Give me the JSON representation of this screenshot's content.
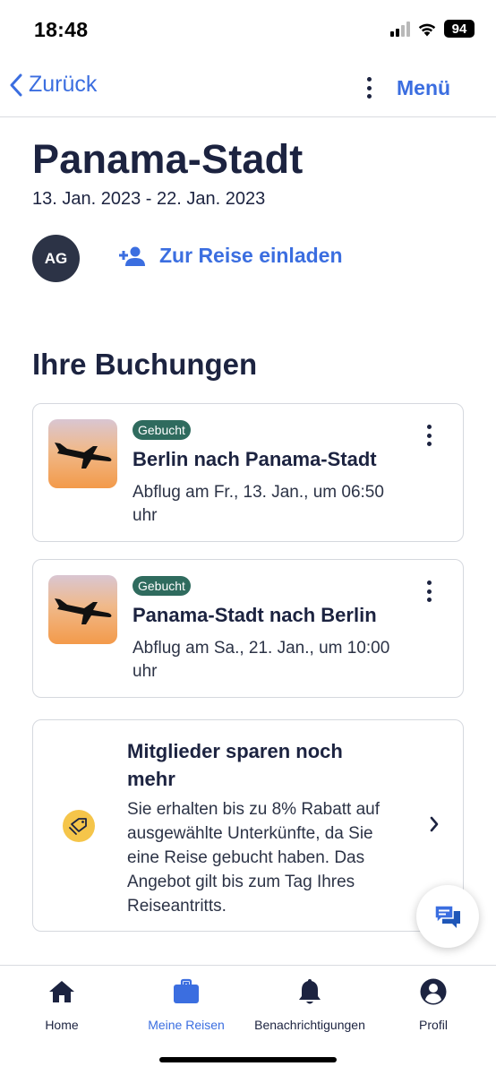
{
  "status_bar": {
    "time": "18:48",
    "battery": "94"
  },
  "nav": {
    "back_label": "Zurück",
    "menu_label": "Menü"
  },
  "trip": {
    "title": "Panama-Stadt",
    "dates": "13. Jan. 2023 - 22. Jan. 2023",
    "avatar_initials": "AG",
    "invite_label": "Zur Reise einladen"
  },
  "bookings": {
    "section_title": "Ihre Buchungen",
    "items": [
      {
        "status": "Gebucht",
        "title": "Berlin nach Panama-Stadt",
        "departure": "Abflug am Fr., 13. Jan., um 06:50 uhr",
        "icon": "airplane-icon"
      },
      {
        "status": "Gebucht",
        "title": "Panama-Stadt nach Berlin",
        "departure": "Abflug am Sa., 21. Jan., um 10:00 uhr",
        "icon": "airplane-icon"
      }
    ]
  },
  "promo": {
    "title": "Mitglieder sparen noch mehr",
    "text": "Sie erhalten bis zu 8% Rabatt auf ausgewählte Unterkünfte, da Sie eine Reise gebucht haben. Das Angebot gilt bis zum Tag Ihres Reiseantritts.",
    "icon": "discount-tag-icon"
  },
  "tabs": [
    {
      "label": "Home",
      "icon": "home-icon",
      "active": false
    },
    {
      "label": "Meine Reisen",
      "icon": "briefcase-icon",
      "active": true
    },
    {
      "label": "Benachrichtigungen",
      "icon": "bell-icon",
      "active": false
    },
    {
      "label": "Profil",
      "icon": "profile-icon",
      "active": false
    }
  ],
  "colors": {
    "accent": "#3b6ee0",
    "text": "#1c2340",
    "badge": "#2f6b5e",
    "promo_icon": "#f5c54a"
  }
}
